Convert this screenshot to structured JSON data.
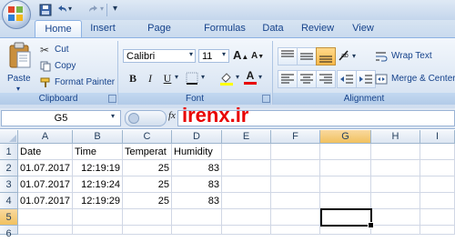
{
  "ribbon_tabs": [
    "Home",
    "Insert",
    "Page Layout",
    "Formulas",
    "Data",
    "Review",
    "View"
  ],
  "clipboard": {
    "paste": "Paste",
    "cut": "Cut",
    "copy": "Copy",
    "format_painter": "Format Painter",
    "group_label": "Clipboard"
  },
  "font": {
    "name": "Calibri",
    "size": "11",
    "bold": "B",
    "italic": "I",
    "underline": "U",
    "group_label": "Font"
  },
  "alignment": {
    "wrap_text": "Wrap Text",
    "merge_center": "Merge & Center",
    "group_label": "Alignment"
  },
  "formula_bar": {
    "name_box": "G5",
    "fx": "fx",
    "formula": ""
  },
  "watermark": "irenx.ir",
  "columns": [
    "A",
    "B",
    "C",
    "D",
    "E",
    "F",
    "G",
    "H",
    "I"
  ],
  "selected_column": "G",
  "rows": [
    {
      "num": "1",
      "cells": [
        "Date",
        "Time",
        "Temperat",
        "Humidity"
      ]
    },
    {
      "num": "2",
      "cells": [
        "01.07.2017",
        "12:19:19",
        "25",
        "83"
      ]
    },
    {
      "num": "3",
      "cells": [
        "01.07.2017",
        "12:19:24",
        "25",
        "83"
      ]
    },
    {
      "num": "4",
      "cells": [
        "01.07.2017",
        "12:19:29",
        "25",
        "83"
      ]
    },
    {
      "num": "5",
      "cells": [
        "",
        "",
        "",
        ""
      ]
    },
    {
      "num": "6",
      "cells": [
        "",
        "",
        "",
        ""
      ]
    }
  ],
  "selected_row": "5",
  "colors": {
    "accent_red": "#e80000",
    "ribbon_blue": "#dfe9f5",
    "selection_orange": "#f1c15f"
  }
}
